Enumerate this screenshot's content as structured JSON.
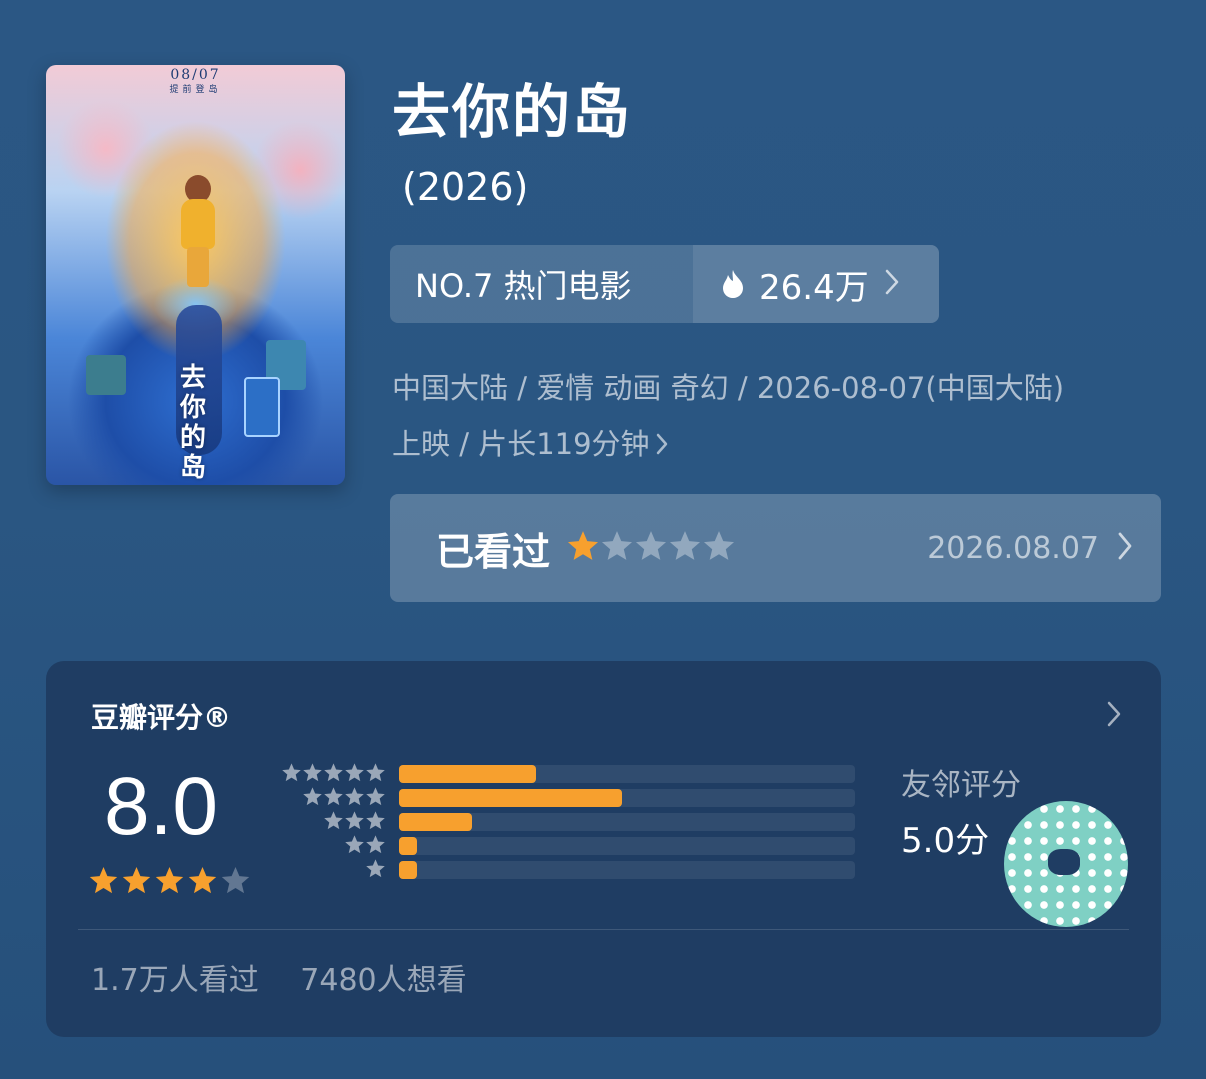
{
  "movie": {
    "title": "去你的岛",
    "year": "(2026)",
    "poster": {
      "release_date": "08/07",
      "release_note": "提前登岛",
      "title_text": "去你的岛"
    }
  },
  "rank": {
    "label": "NO.7 热门电影",
    "heat_icon": "flame-icon",
    "heat": "26.4万"
  },
  "meta": {
    "line1": "中国大陆 / 爱情 动画 奇幻 / 2026-08-07(中国大陆)",
    "line2": "上映 / 片长119分钟"
  },
  "seen": {
    "label": "已看过",
    "user_rating": 1,
    "max_rating": 5,
    "date": "2026.08.07"
  },
  "rating_card": {
    "title": "豆瓣评分®",
    "score": "8.0",
    "score_stars": 4,
    "distribution": [
      {
        "stars": 5,
        "fraction": 0.3
      },
      {
        "stars": 4,
        "fraction": 0.49
      },
      {
        "stars": 3,
        "fraction": 0.16
      },
      {
        "stars": 2,
        "fraction": 0.04
      },
      {
        "stars": 1,
        "fraction": 0.04
      }
    ],
    "friend_label": "友邻评分",
    "friend_score": "5.0分",
    "watched": "1.7万人看过",
    "want": "7480人想看"
  },
  "colors": {
    "accent": "#f7a02e",
    "background": "#2a5682",
    "card": "#1f3d63"
  }
}
